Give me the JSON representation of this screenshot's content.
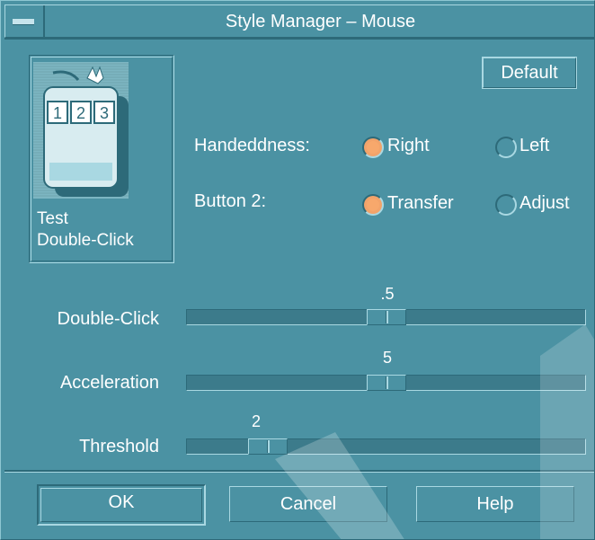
{
  "window": {
    "title": "Style Manager – Mouse",
    "menu_icon": "window-menu-icon"
  },
  "test_area": {
    "label_line1": "Test",
    "label_line2": "Double-Click",
    "icon": "mouse-icon",
    "button_numbers": [
      "1",
      "2",
      "3"
    ]
  },
  "default_button": "Default",
  "handedness": {
    "label": "Handeddness:",
    "options": [
      {
        "label": "Right",
        "selected": true
      },
      {
        "label": "Left",
        "selected": false
      }
    ]
  },
  "button2": {
    "label": "Button 2:",
    "options": [
      {
        "label": "Transfer",
        "selected": true
      },
      {
        "label": "Adjust",
        "selected": false
      }
    ]
  },
  "sliders": [
    {
      "label": "Double-Click",
      "value": ".5",
      "position_fraction": 0.5
    },
    {
      "label": "Acceleration",
      "value": "5",
      "position_fraction": 0.5
    },
    {
      "label": "Threshold",
      "value": "2",
      "position_fraction": 0.17
    }
  ],
  "buttons": {
    "ok": "OK",
    "cancel": "Cancel",
    "help": "Help"
  },
  "colors": {
    "background": "#4b92a3",
    "selected_radio": "#f7a86c",
    "text": "#ffffff"
  }
}
